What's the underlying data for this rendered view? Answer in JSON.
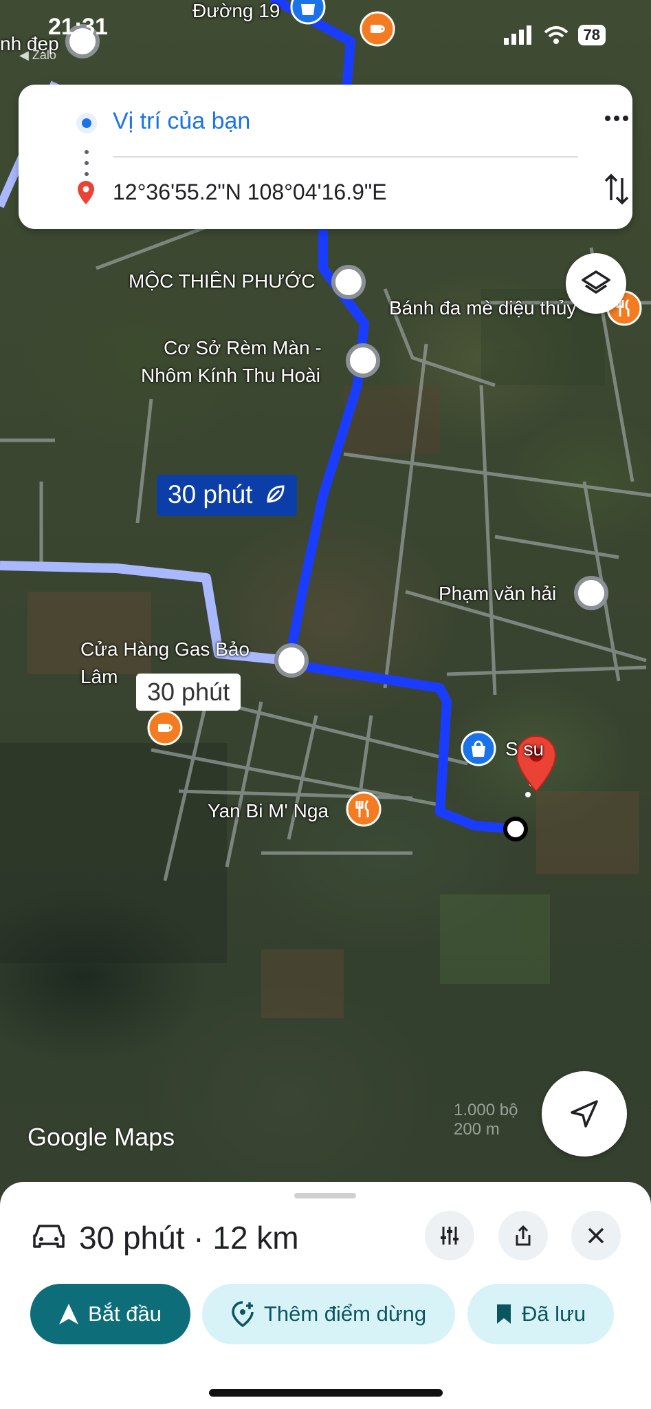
{
  "status_bar": {
    "time": "21:31",
    "back_app": "◀ Zalo",
    "battery": "78"
  },
  "route": {
    "origin": "Vị trí của bạn",
    "destination": "12°36'55.2\"N 108°04'16.9\"E"
  },
  "map": {
    "labels": {
      "road": "Đường 19",
      "left_top": "nh đẹp",
      "moc": "MỘC THIÊN PHƯỚC",
      "banh": "Bánh đa mè diệu thủy",
      "rem1": "Cơ Sở Rèm Màn -",
      "rem2": "Nhôm Kính Thu Hoài",
      "pham": "Phạm văn hải",
      "gas1": "Cửa Hàng Gas Bảo",
      "gas2": "Lâm",
      "yan": "Yan Bi M' Nga",
      "s_su": "S          su"
    },
    "duration_main": "30 phút",
    "duration_alt": "30 phút",
    "brand": "Google Maps",
    "scale_ft": "1.000 bộ",
    "scale_m": "200 m"
  },
  "sheet": {
    "summary": "30 phút · 12 km",
    "start": "Bắt đầu",
    "add_stop": "Thêm điểm dừng",
    "saved": "Đã lưu"
  },
  "colors": {
    "route_main": "#1a3cff",
    "route_alt": "#a9b8ff",
    "accent": "#0d6e7a",
    "pin": "#ea4335"
  }
}
